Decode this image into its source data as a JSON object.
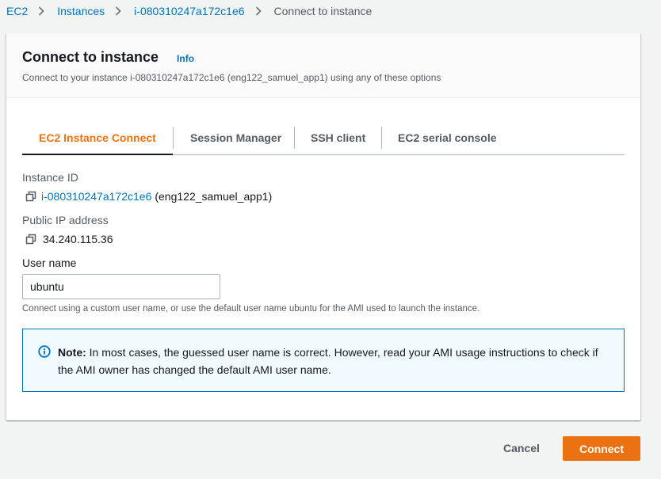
{
  "breadcrumb": {
    "items": [
      "EC2",
      "Instances",
      "i-080310247a172c1e6"
    ],
    "current": "Connect to instance"
  },
  "header": {
    "title": "Connect to instance",
    "info": "Info",
    "description": "Connect to your instance i-080310247a172c1e6 (eng122_samuel_app1) using any of these options"
  },
  "tabs": [
    {
      "label": "EC2 Instance Connect",
      "active": true
    },
    {
      "label": "Session Manager",
      "active": false
    },
    {
      "label": "SSH client",
      "active": false
    },
    {
      "label": "EC2 serial console",
      "active": false
    }
  ],
  "instance": {
    "id_label": "Instance ID",
    "id": "i-080310247a172c1e6",
    "name": "(eng122_samuel_app1)",
    "ip_label": "Public IP address",
    "ip": "34.240.115.36"
  },
  "user": {
    "label": "User name",
    "value": "ubuntu",
    "hint": "Connect using a custom user name, or use the default user name ubuntu for the AMI used to launch the instance."
  },
  "note": {
    "title": "Note:",
    "text": "In most cases, the guessed user name is correct. However, read your AMI usage instructions to check if the AMI owner has changed the default AMI user name."
  },
  "footer": {
    "cancel": "Cancel",
    "connect": "Connect"
  },
  "colors": {
    "accent": "#ec7211",
    "link": "#0073bb",
    "info_bg": "#f1faff"
  }
}
